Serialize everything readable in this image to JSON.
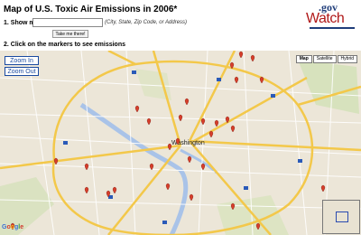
{
  "header": {
    "title": "Map of U.S. Toxic Air Emissions in 2006*",
    "logo_gov": ".gov",
    "logo_watch": "Watch"
  },
  "form": {
    "show_label": "1. Show me:",
    "input_value": "",
    "hint": "(City, State, Zip Code, or Address)",
    "take_button": "Take me there!"
  },
  "step2": "2. Click on the markers to see emissions",
  "map": {
    "zoom_in": "Zoom In",
    "zoom_out": "Zoom Out",
    "map_types": [
      "Map",
      "Satellite",
      "Hybrid"
    ],
    "active_type": "Map",
    "city_label": "Washington",
    "google": "Google",
    "marker_color": "#d63d2a",
    "highway_color": "#f3c84a",
    "water_color": "#a9c3e8",
    "park_color": "#c8dca9"
  }
}
